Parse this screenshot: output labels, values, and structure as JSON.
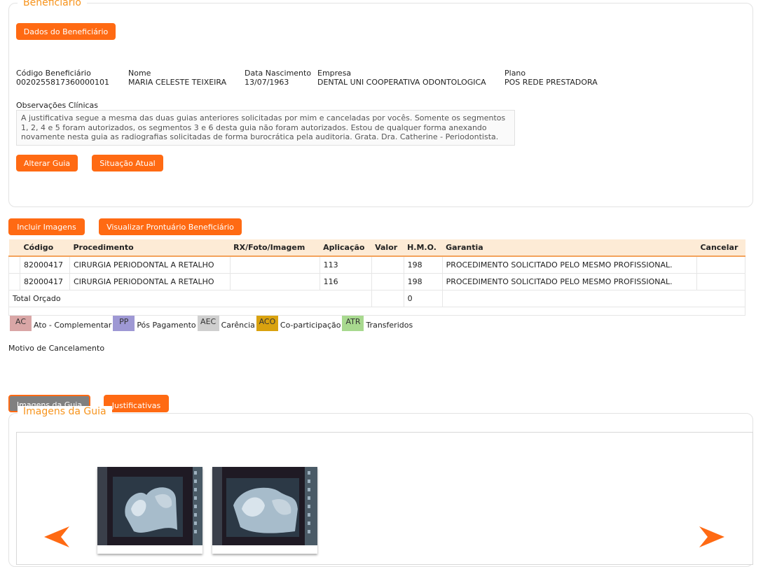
{
  "beneficiario": {
    "legend": "Beneficiário",
    "dados_button": "Dados do Beneficiário",
    "fields": [
      {
        "label": "Código Beneficiário",
        "value": "0020255817360000101"
      },
      {
        "label": "Nome",
        "value": "MARIA CELESTE TEIXEIRA"
      },
      {
        "label": "Data Nascimento",
        "value": "13/07/1963"
      },
      {
        "label": "Empresa",
        "value": "DENTAL UNI COOPERATIVA ODONTOLOGICA"
      },
      {
        "label": "Plano",
        "value": "POS REDE PRESTADORA"
      }
    ],
    "obs_label": "Observações Clínicas",
    "obs_text": "A justificativa segue a mesma das duas guias anteriores solicitadas por mim e canceladas por vocês. Somente os segmentos 1, 2, 4 e 5 foram autorizados, os segmentos 3 e 6 desta guia não foram autorizados. Estou de qualquer forma anexando novamente nesta guia as radiografias solicitadas de forma burocrática pela auditoria. Grata. Dra. Catherine - Periodontista.",
    "alterar_button": "Alterar Guia",
    "situacao_button": "Situação Atual"
  },
  "actions": {
    "incluir_button": "Incluir Imagens",
    "prontuario_button": "Visualizar Prontuário Beneficiário"
  },
  "table": {
    "headers": [
      "Código",
      "Procedimento",
      "RX/Foto/Imagem",
      "Aplicação",
      "Valor",
      "H.M.O.",
      "Garantia",
      "Cancelar"
    ],
    "rows": [
      {
        "codigo": "82000417",
        "procedimento": "CIRURGIA PERIODONTAL A RETALHO",
        "rx": "",
        "aplicacao": "113",
        "valor": "",
        "hmo": "198",
        "garantia": "PROCEDIMENTO SOLICITADO PELO MESMO PROFISSIONAL.",
        "cancelar": ""
      },
      {
        "codigo": "82000417",
        "procedimento": "CIRURGIA PERIODONTAL A RETALHO",
        "rx": "",
        "aplicacao": "116",
        "valor": "",
        "hmo": "198",
        "garantia": "PROCEDIMENTO SOLICITADO PELO MESMO PROFISSIONAL.",
        "cancelar": ""
      }
    ],
    "total_label": "Total Orçado",
    "total_value": "0"
  },
  "legend_items": [
    {
      "code": "AC",
      "label": "Ato - Complementar",
      "color": "#d9a6a6"
    },
    {
      "code": "PP",
      "label": "Pós Pagamento",
      "color": "#9e98d4"
    },
    {
      "code": "AEC",
      "label": "Carência",
      "color": "#cfcfcf"
    },
    {
      "code": "ACO",
      "label": "Co-participação",
      "color": "#d9a20f"
    },
    {
      "code": "ATR",
      "label": "Transferidos",
      "color": "#a8d98f"
    }
  ],
  "motivo_label": "Motivo de Cancelamento",
  "tabs": {
    "imagens_tab": "Imagens da Guia",
    "justificativas_tab": "Justificativas"
  },
  "imagens": {
    "legend": "Imagens da Guia"
  },
  "colors": {
    "accent": "#ff6a13",
    "legend_text": "#f7941d",
    "header_bg": "#fdebd6"
  }
}
